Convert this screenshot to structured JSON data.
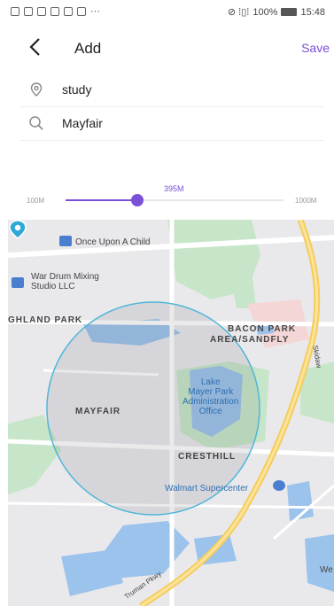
{
  "status_bar": {
    "icons": [
      "sim-icon",
      "wifi-icon",
      "usb-icon",
      "image-icon",
      "photos-icon",
      "mail-icon",
      "more-icon"
    ],
    "network": "⊘ ⁞▯⁞",
    "battery": "100%",
    "time": "15:48"
  },
  "header": {
    "title": "Add",
    "save_label": "Save"
  },
  "form": {
    "name_value": "study",
    "search_value": "Mayfair"
  },
  "radius": {
    "min_label": "100M",
    "max_label": "1000M",
    "current_label": "395M",
    "value": 395,
    "min": 100,
    "max": 1000
  },
  "map": {
    "labels": {
      "once_upon": "Once Upon A Child",
      "war_drum": "War Drum Mixing\nStudio LLC",
      "highland": "GHLAND PARK",
      "bacon": "BACON PARK",
      "area_sandfly": "AREA/SANDFLY",
      "mayfair": "MAYFAIR",
      "lake_mayer": "Lake\nMayer Park\nAdministration\nOffice",
      "cresthill": "CRESTHILL",
      "walmart": "Walmart Supercenter",
      "skidaway": "Skidaw",
      "we": "We",
      "truman": "Truman Pkwy"
    }
  },
  "colors": {
    "accent": "#7b4fd6",
    "circle": "#4fb6d8"
  }
}
